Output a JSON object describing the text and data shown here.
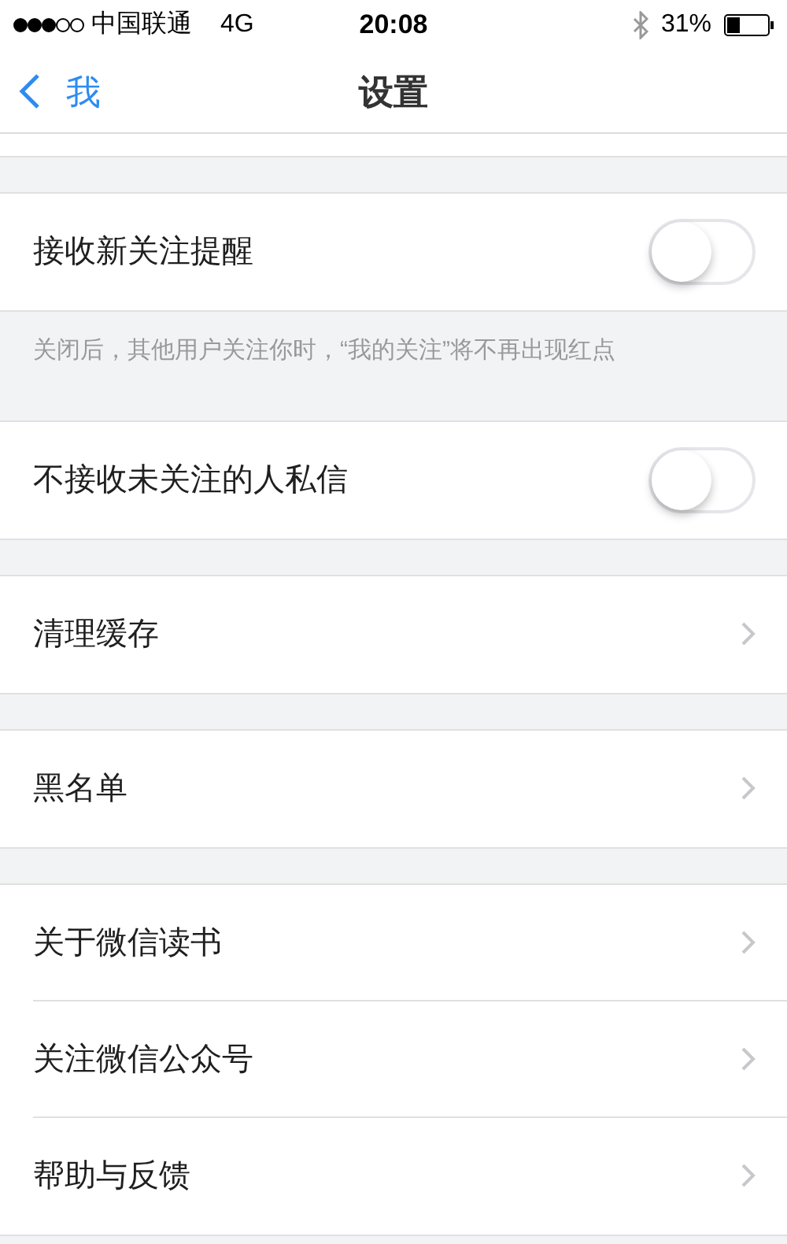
{
  "status_bar": {
    "carrier": "中国联通",
    "network": "4G",
    "time": "20:08",
    "battery": "31%"
  },
  "nav": {
    "back": "我",
    "title": "设置"
  },
  "sections": [
    {
      "rows": [
        {
          "kind": "toggle",
          "label": "接收新关注提醒",
          "on": false
        }
      ],
      "note": "关闭后，其他用户关注你时，“我的关注”将不再出现红点"
    },
    {
      "rows": [
        {
          "kind": "toggle",
          "label": "不接收未关注的人私信",
          "on": false
        }
      ]
    },
    {
      "rows": [
        {
          "kind": "link",
          "label": "清理缓存"
        }
      ]
    },
    {
      "rows": [
        {
          "kind": "link",
          "label": "黑名单"
        }
      ]
    },
    {
      "rows": [
        {
          "kind": "link",
          "label": "关于微信读书"
        },
        {
          "kind": "link",
          "label": "关注微信公众号"
        },
        {
          "kind": "link",
          "label": "帮助与反馈"
        }
      ]
    }
  ]
}
